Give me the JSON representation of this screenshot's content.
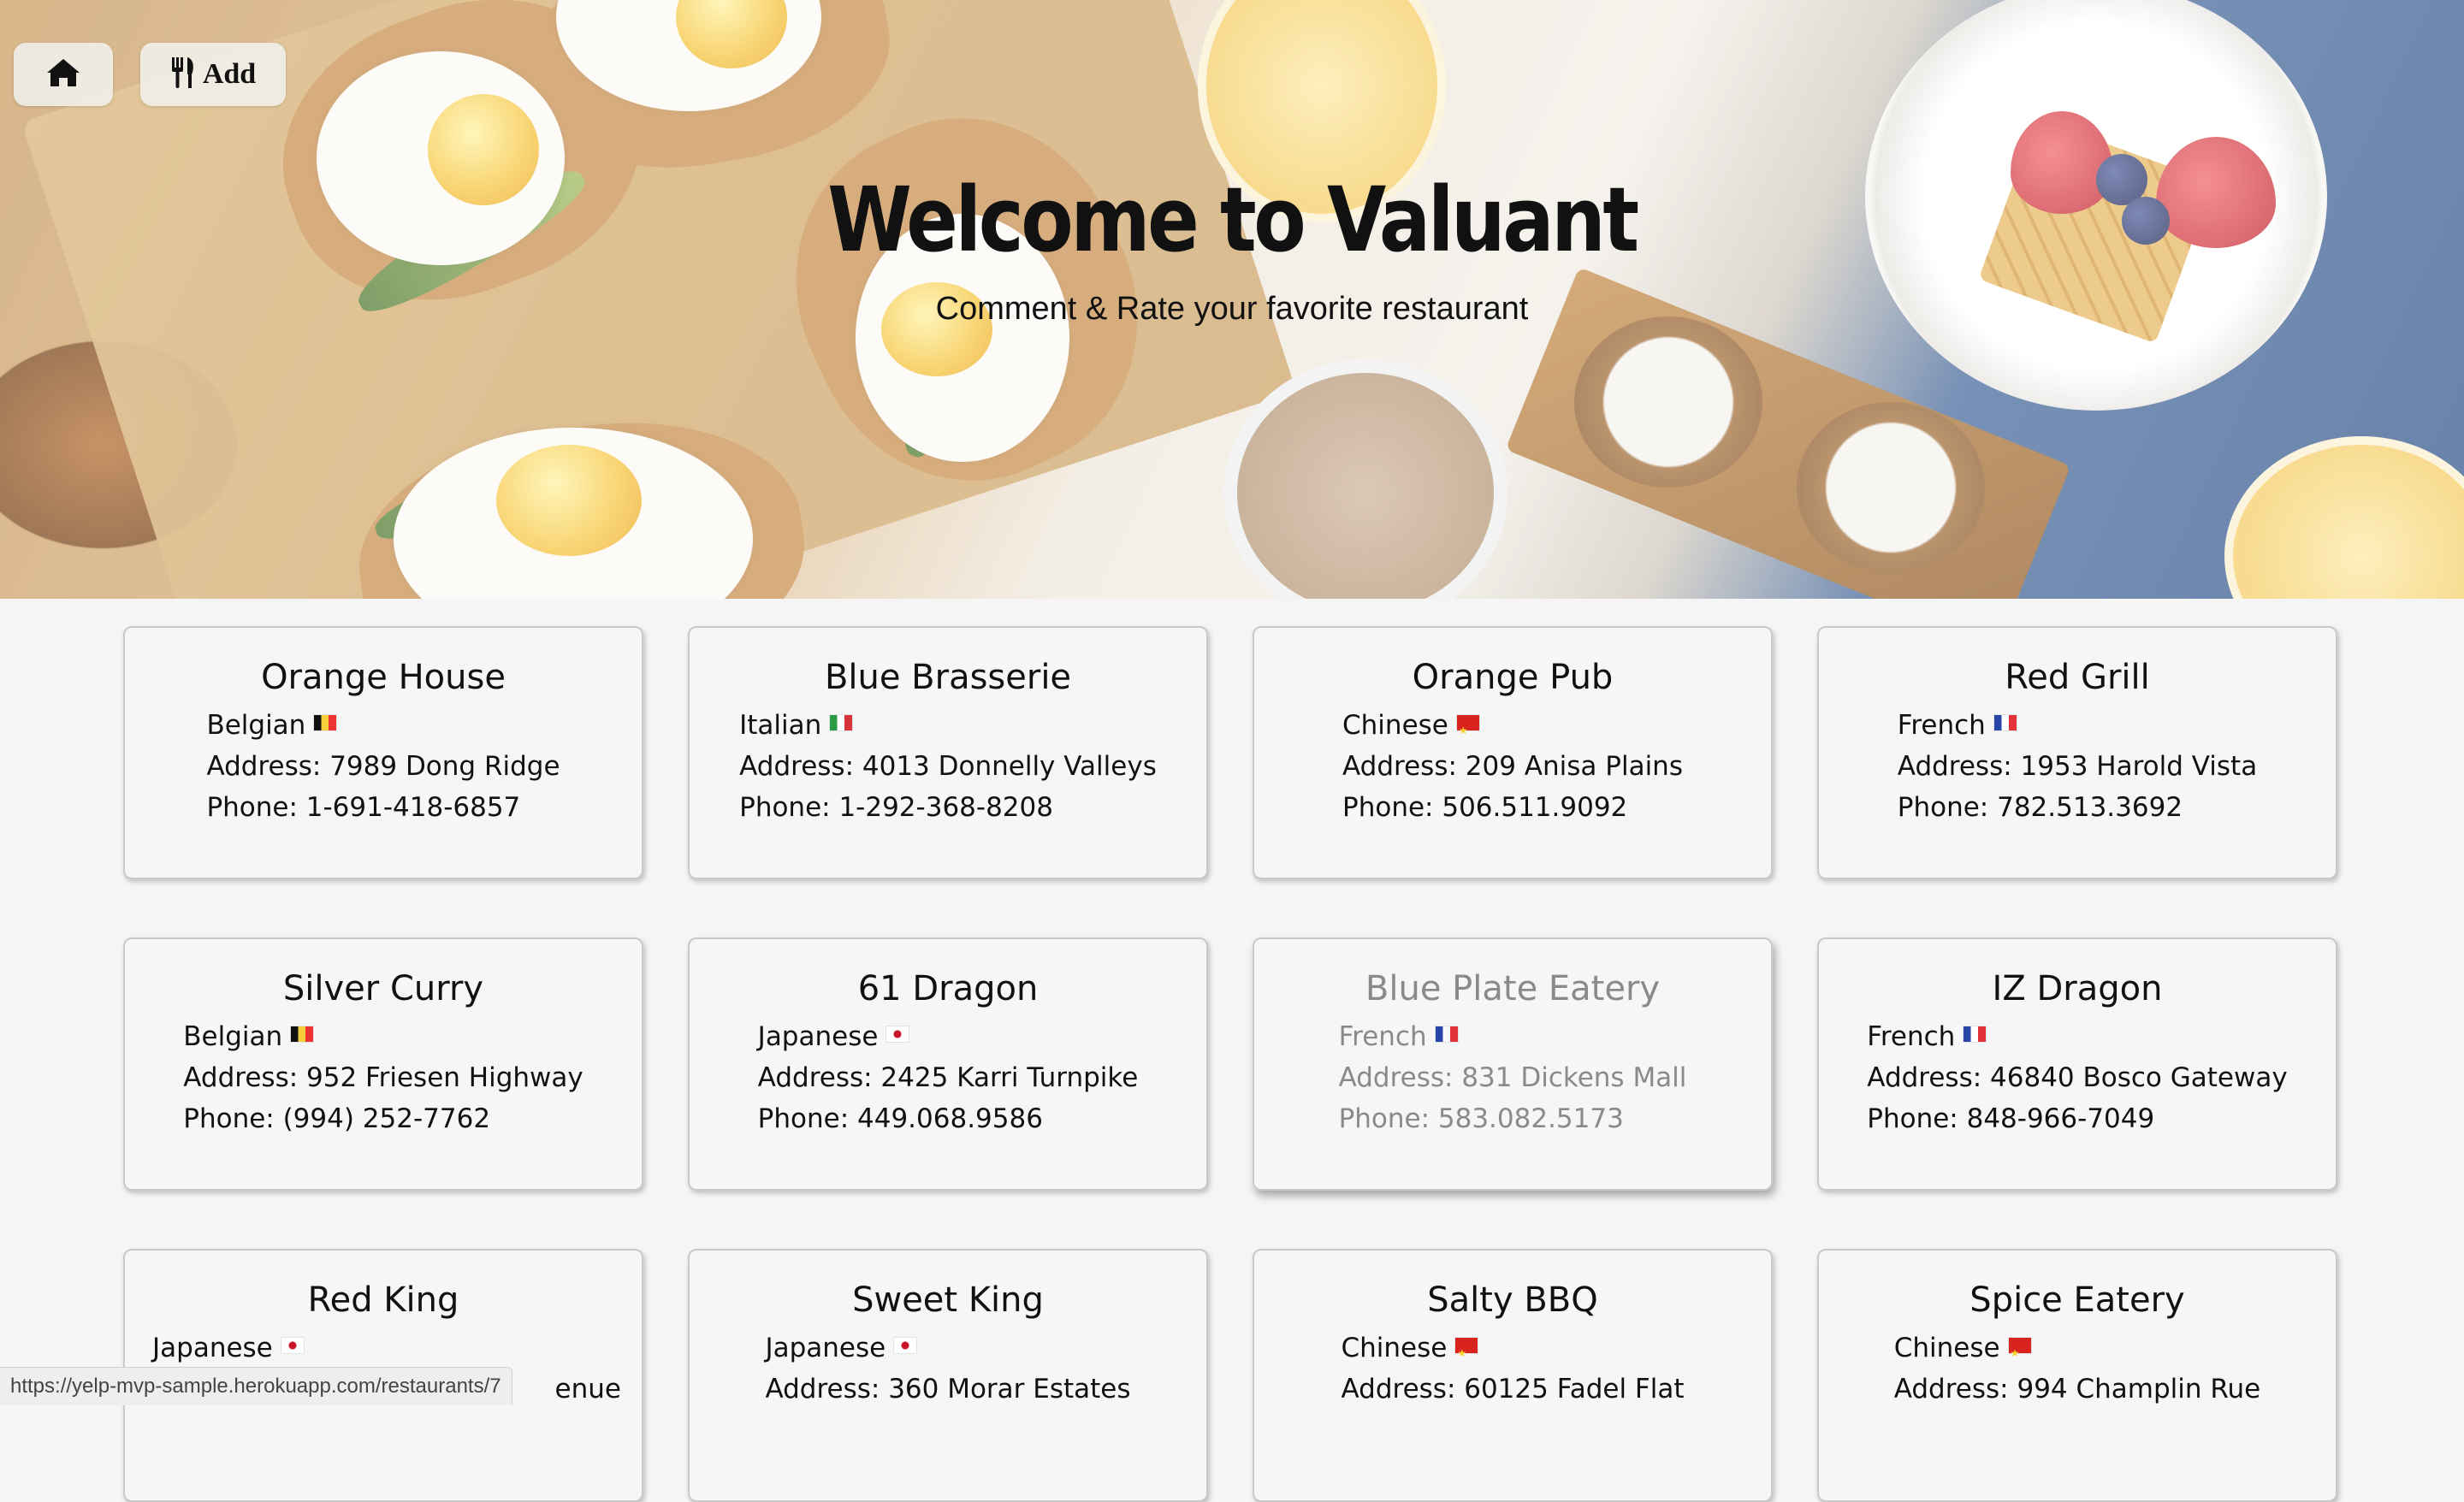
{
  "nav": {
    "home_icon": "home-icon",
    "add_icon": "utensils-icon",
    "add_label": "Add"
  },
  "hero": {
    "title": "Welcome to Valuant",
    "subtitle": "Comment & Rate your favorite restaurant"
  },
  "restaurants": [
    {
      "name": "Orange House",
      "cuisine": "Belgian",
      "flag": "be",
      "address": "Address: 7989 Dong Ridge",
      "phone": "Phone: 1-691-418-6857"
    },
    {
      "name": "Blue Brasserie",
      "cuisine": "Italian",
      "flag": "it",
      "address": "Address: 4013 Donnelly Valleys",
      "phone": "Phone: 1-292-368-8208"
    },
    {
      "name": "Orange Pub",
      "cuisine": "Chinese",
      "flag": "cn",
      "address": "Address: 209 Anisa Plains",
      "phone": "Phone: 506.511.9092"
    },
    {
      "name": "Red Grill",
      "cuisine": "French",
      "flag": "fr",
      "address": "Address: 1953 Harold Vista",
      "phone": "Phone: 782.513.3692"
    },
    {
      "name": "Silver Curry",
      "cuisine": "Belgian",
      "flag": "be",
      "address": "Address: 952 Friesen Highway",
      "phone": "Phone: (994) 252-7762"
    },
    {
      "name": "61 Dragon",
      "cuisine": "Japanese",
      "flag": "jp",
      "address": "Address: 2425 Karri Turnpike",
      "phone": "Phone: 449.068.9586"
    },
    {
      "name": "Blue Plate Eatery",
      "cuisine": "French",
      "flag": "fr",
      "address": "Address: 831 Dickens Mall",
      "phone": "Phone: 583.082.5173",
      "hovered": true
    },
    {
      "name": "IZ Dragon",
      "cuisine": "French",
      "flag": "fr",
      "address": "Address: 46840 Bosco Gateway",
      "phone": "Phone: 848-966-7049"
    },
    {
      "name": "Red King",
      "cuisine": "Japanese",
      "flag": "jp",
      "address": "enue",
      "phone": ""
    },
    {
      "name": "Sweet King",
      "cuisine": "Japanese",
      "flag": "jp",
      "address": "Address: 360 Morar Estates",
      "phone": ""
    },
    {
      "name": "Salty BBQ",
      "cuisine": "Chinese",
      "flag": "cn",
      "address": "Address: 60125 Fadel Flat",
      "phone": ""
    },
    {
      "name": "Spice Eatery",
      "cuisine": "Chinese",
      "flag": "cn",
      "address": "Address: 994 Champlin Rue",
      "phone": ""
    }
  ],
  "status_bar": {
    "url": "https://yelp-mvp-sample.herokuapp.com/restaurants/7"
  }
}
